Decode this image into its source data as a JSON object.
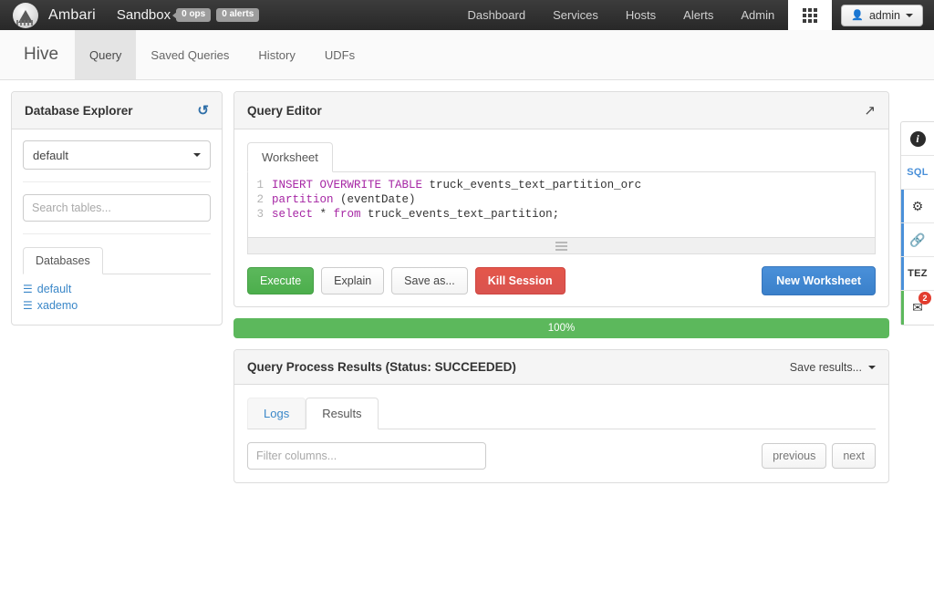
{
  "topnav": {
    "brand": "Ambari",
    "cluster": "Sandbox",
    "ops_badge": "0 ops",
    "alerts_badge": "0 alerts",
    "links": [
      {
        "label": "Dashboard",
        "name": "nav-dashboard"
      },
      {
        "label": "Services",
        "name": "nav-services"
      },
      {
        "label": "Hosts",
        "name": "nav-hosts"
      },
      {
        "label": "Alerts",
        "name": "nav-alerts"
      },
      {
        "label": "Admin",
        "name": "nav-admin"
      }
    ],
    "grid_icon": "grid-apps-icon",
    "user": "admin",
    "user_icon": "user-icon"
  },
  "subnav": {
    "app_title": "Hive",
    "tabs": [
      {
        "label": "Query",
        "active": true
      },
      {
        "label": "Saved Queries",
        "active": false
      },
      {
        "label": "History",
        "active": false
      },
      {
        "label": "UDFs",
        "active": false
      }
    ]
  },
  "explorer": {
    "title": "Database Explorer",
    "refresh_icon": "refresh-icon",
    "selected_database": "default",
    "dropdown_icon": "chevron-down-icon",
    "search_placeholder": "Search tables...",
    "tab_label": "Databases",
    "databases": [
      {
        "name": "default",
        "icon": "database-icon"
      },
      {
        "name": "xademo",
        "icon": "database-icon"
      }
    ]
  },
  "query_editor": {
    "title": "Query Editor",
    "expand_icon": "expand-diagonal-icon",
    "worksheet_tab": "Worksheet",
    "code_lines": [
      {
        "num": "1",
        "tokens": [
          {
            "t": "INSERT OVERWRITE TABLE",
            "c": "kw"
          },
          {
            "t": " truck_events_text_partition_orc",
            "c": "plain"
          }
        ]
      },
      {
        "num": "2",
        "tokens": [
          {
            "t": "partition",
            "c": "kw"
          },
          {
            "t": " (eventDate)",
            "c": "plain"
          }
        ]
      },
      {
        "num": "3",
        "tokens": [
          {
            "t": "select",
            "c": "kw"
          },
          {
            "t": " * ",
            "c": "plain"
          },
          {
            "t": "from",
            "c": "kw"
          },
          {
            "t": " truck_events_text_partition;",
            "c": "plain"
          }
        ]
      }
    ],
    "resize_handle_icon": "resize-grip-icon",
    "buttons": {
      "execute": "Execute",
      "explain": "Explain",
      "save_as": "Save as...",
      "kill_session": "Kill Session",
      "new_worksheet": "New Worksheet"
    }
  },
  "progress": {
    "percent_label": "100%",
    "percent_value": 100,
    "color": "#5cb85c"
  },
  "results": {
    "title": "Query Process Results (Status: SUCCEEDED)",
    "save_results": "Save results...",
    "save_results_caret": "chevron-down-icon",
    "tabs": [
      {
        "label": "Logs",
        "active": false
      },
      {
        "label": "Results",
        "active": true
      }
    ],
    "filter_placeholder": "Filter columns...",
    "previous": "previous",
    "next": "next"
  },
  "rail": [
    {
      "type": "icon",
      "glyph": "i",
      "name": "info-icon",
      "badge": null
    },
    {
      "type": "label",
      "text": "SQL",
      "name": "sql-tab",
      "badge": null
    },
    {
      "type": "icon",
      "glyph": "⚙",
      "name": "gear-icon",
      "badge": null
    },
    {
      "type": "icon",
      "glyph": "🔗",
      "name": "link-icon",
      "badge": null
    },
    {
      "type": "label",
      "text": "TEZ",
      "name": "tez-tab",
      "badge": null
    },
    {
      "type": "icon",
      "glyph": "✉",
      "name": "envelope-icon",
      "badge": "2"
    }
  ]
}
